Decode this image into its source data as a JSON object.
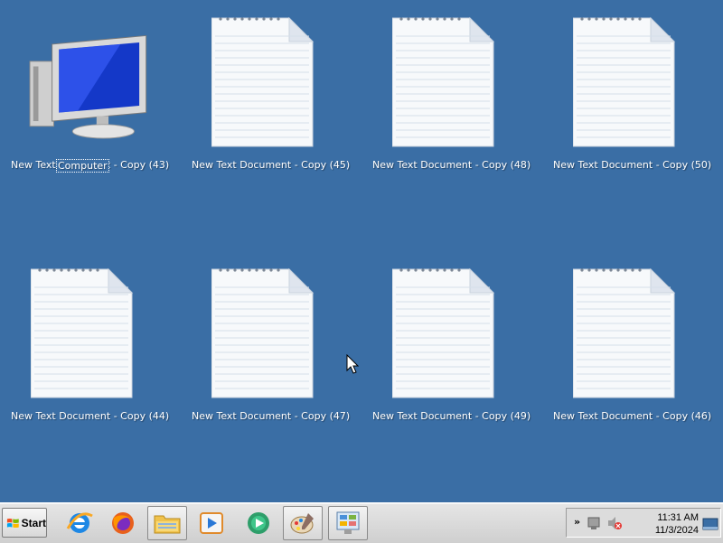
{
  "desktop": {
    "icons": [
      {
        "label": "New Text Document - Copy (43)",
        "overlay_text": "Computer",
        "kind": "computer"
      },
      {
        "label": "New Text Document - Copy (45)",
        "kind": "text"
      },
      {
        "label": "New Text Document - Copy (48)",
        "kind": "text"
      },
      {
        "label": "New Text Document - Copy (50)",
        "kind": "text"
      },
      {
        "label": "New Text Document - Copy (44)",
        "kind": "text"
      },
      {
        "label": "New Text Document - Copy (47)",
        "kind": "text"
      },
      {
        "label": "New Text Document - Copy (49)",
        "kind": "text"
      },
      {
        "label": "New Text Document - Copy (46)",
        "kind": "text"
      }
    ],
    "background_color": "#3a6ea5"
  },
  "taskbar": {
    "start_label": "Start",
    "quick_launch": [
      {
        "name": "internet-explorer-icon"
      },
      {
        "name": "firefox-icon"
      },
      {
        "name": "file-explorer-icon"
      },
      {
        "name": "media-player-icon"
      },
      {
        "name": "media-center-icon"
      },
      {
        "name": "paint-icon"
      },
      {
        "name": "control-panel-icon"
      }
    ],
    "tray": {
      "show_hidden_label": "»",
      "time": "11:31 AM",
      "date": "11/3/2024"
    }
  }
}
